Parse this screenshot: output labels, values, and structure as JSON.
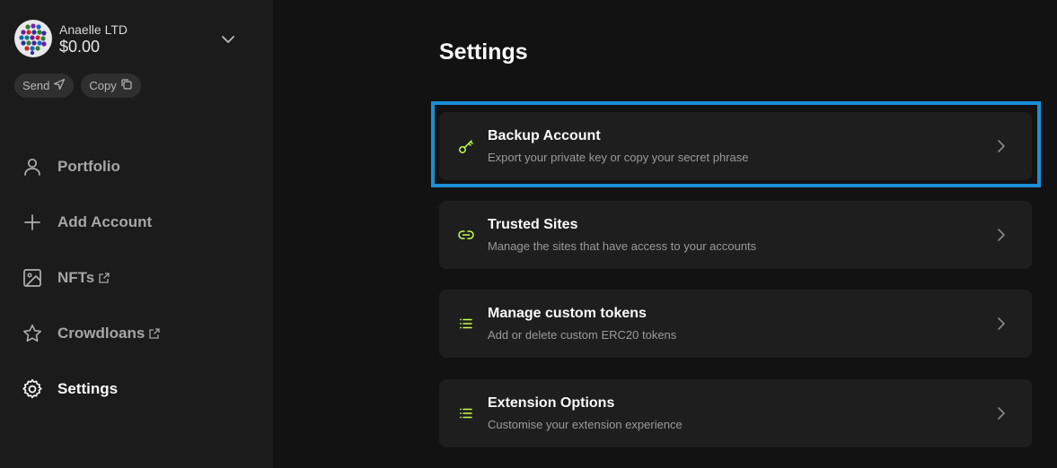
{
  "account": {
    "name": "Anaelle LTD",
    "balance": "$0.00",
    "send_label": "Send",
    "copy_label": "Copy"
  },
  "nav": {
    "items": [
      {
        "label": "Portfolio",
        "icon": "user-icon"
      },
      {
        "label": "Add Account",
        "icon": "plus-icon"
      },
      {
        "label": "NFTs",
        "icon": "image-icon",
        "external": true
      },
      {
        "label": "Crowdloans",
        "icon": "star-icon",
        "external": true
      },
      {
        "label": "Settings",
        "icon": "gear-icon",
        "active": true
      }
    ]
  },
  "main": {
    "title": "Settings",
    "cards": [
      {
        "title": "Backup Account",
        "subtitle": "Export your private key or copy your secret phrase",
        "icon": "key-icon"
      },
      {
        "title": "Trusted Sites",
        "subtitle": "Manage the sites that have access to your accounts",
        "icon": "link-icon"
      },
      {
        "title": "Manage custom tokens",
        "subtitle": "Add or delete custom ERC20 tokens",
        "icon": "list-icon"
      },
      {
        "title": "Extension Options",
        "subtitle": "Customise your extension experience",
        "icon": "list-icon"
      }
    ]
  },
  "colors": {
    "accent_icon": "#c5ff4a",
    "highlight_border": "#1a8fd6",
    "sidebar_bg": "#1b1b1b",
    "main_bg": "#121212",
    "card_bg": "#1e1e1e"
  }
}
